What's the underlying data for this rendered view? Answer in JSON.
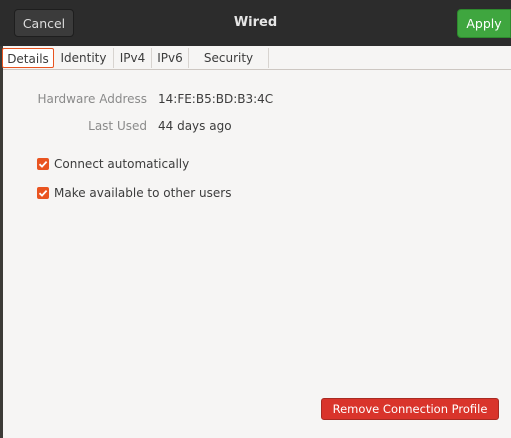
{
  "header": {
    "title": "Wired",
    "cancel_label": "Cancel",
    "apply_label": "Apply"
  },
  "tabs": [
    {
      "label": "Details",
      "active": true
    },
    {
      "label": "Identity",
      "active": false
    },
    {
      "label": "IPv4",
      "active": false
    },
    {
      "label": "IPv6",
      "active": false
    },
    {
      "label": "Security",
      "active": false
    }
  ],
  "details": {
    "hardware_address_label": "Hardware Address",
    "hardware_address_value": "14:FE:B5:BD:B3:4C",
    "last_used_label": "Last Used",
    "last_used_value": "44 days ago"
  },
  "options": {
    "connect_automatically": {
      "label": "Connect automatically",
      "checked": true
    },
    "available_to_others": {
      "label": "Make available to other users",
      "checked": true
    }
  },
  "actions": {
    "remove_label": "Remove Connection Profile"
  },
  "colors": {
    "accent": "#e95420",
    "apply": "#3fa63f",
    "destructive": "#d9342b",
    "headerbar": "#2c2c2c"
  }
}
